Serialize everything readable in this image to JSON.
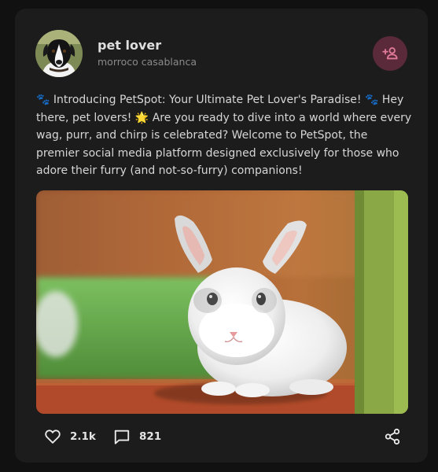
{
  "post": {
    "author": {
      "name": "pet lover",
      "location": "morroco casablanca",
      "avatar_icon": "dog-avatar"
    },
    "text": "🐾 Introducing PetSpot: Your Ultimate Pet Lover's Paradise! 🐾 Hey there, pet lovers! 🌟 Are you ready to dive into a world where every wag, purr, and chirp is celebrated? Welcome to PetSpot, the premier social media platform designed exclusively for those who adore their furry (and not-so-furry) companions!",
    "image_icon": "white-rabbit-photo",
    "likes": "2.1k",
    "comments": "821",
    "follow_icon": "add-user-icon",
    "share_icon": "share-icon"
  },
  "colors": {
    "page_bg": "#111111",
    "card_bg": "#1c1c1c",
    "follow_bg": "#5b2a3a",
    "follow_icon": "#e07a98"
  }
}
